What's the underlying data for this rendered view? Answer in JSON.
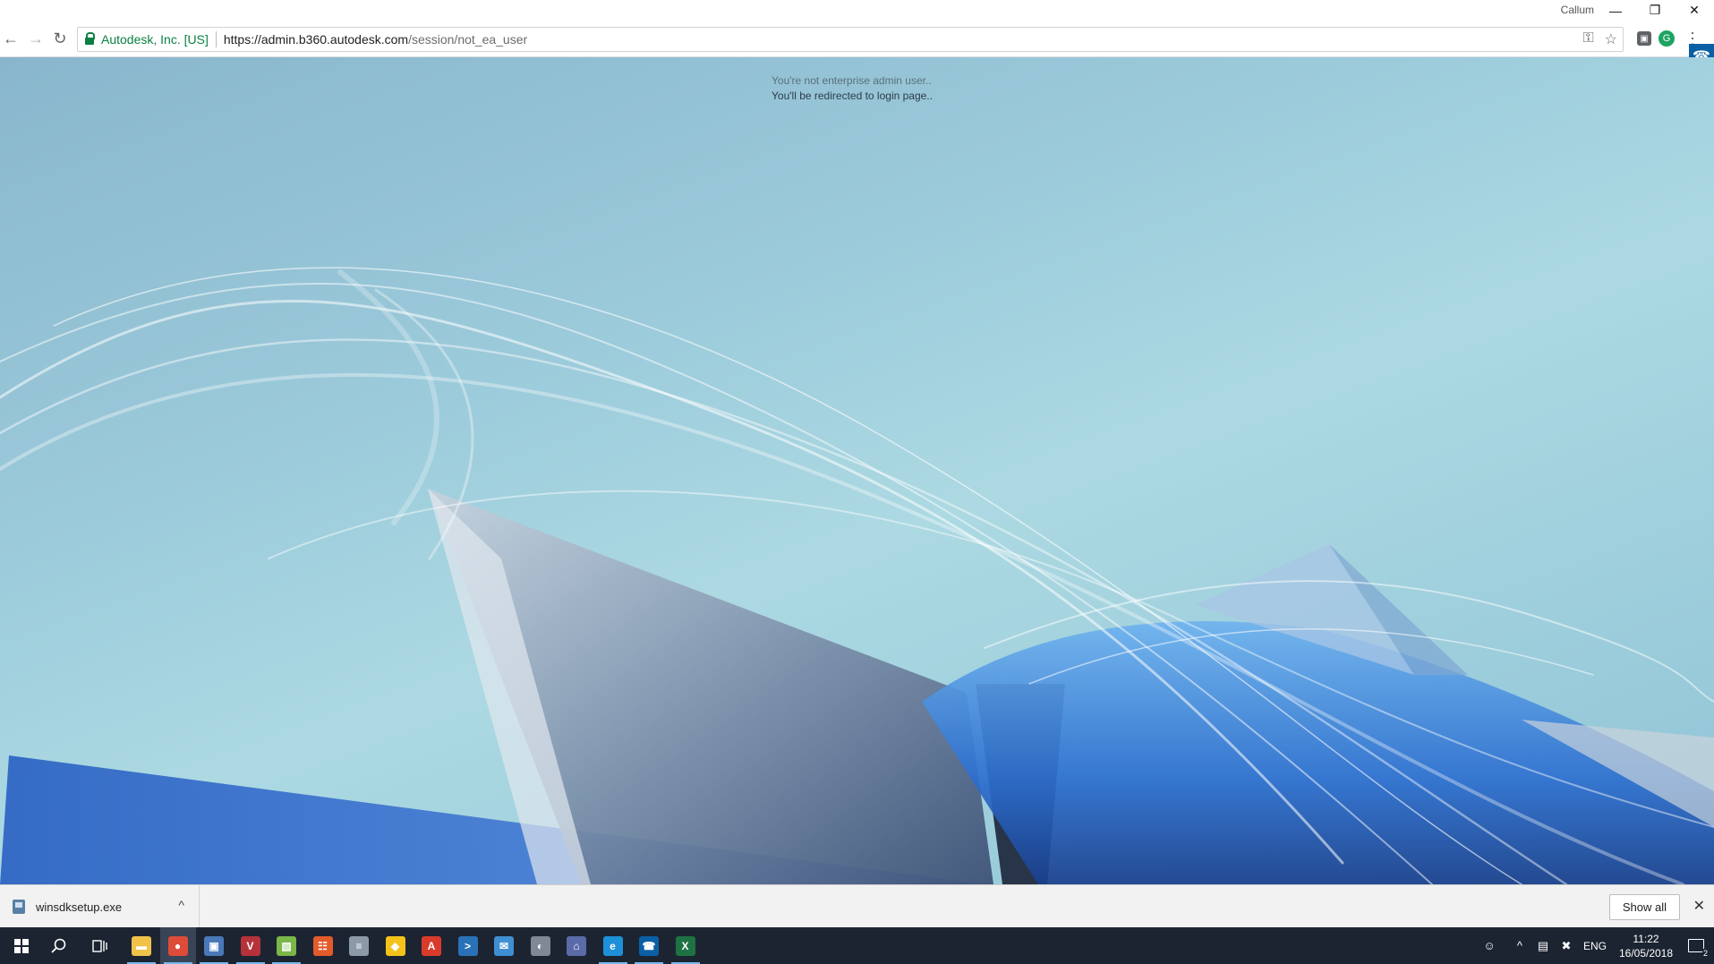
{
  "window": {
    "profile_name": "Callum",
    "minimize_label": "—",
    "restore_label": "❐",
    "close_label": "✕"
  },
  "toolbar": {
    "back_icon": "←",
    "forward_icon": "→",
    "reload_icon": "↻",
    "ev_name": "Autodesk, Inc. [US]",
    "url_host": "https://admin.b360.autodesk.com",
    "url_path": "/session/not_ea_user",
    "key_icon": "⚿",
    "star_icon": "☆",
    "ext1_label": "▣",
    "ext2_label": "G",
    "menu_icon": "⋮",
    "phone_icon": "☎"
  },
  "page": {
    "message_line1": "You're not enterprise admin user..",
    "message_line2": "You'll be redirected to login page.."
  },
  "downloads": {
    "file_name": "winsdksetup.exe",
    "chevron": "^",
    "show_all_label": "Show all",
    "close_label": "✕"
  },
  "taskbar": {
    "apps": [
      {
        "name": "file-explorer",
        "glyph": "▬",
        "color": "#f0c24a"
      },
      {
        "name": "chrome",
        "glyph": "●",
        "color": "#dd4b39"
      },
      {
        "name": "remote-desktop",
        "glyph": "▣",
        "color": "#4a78b8"
      },
      {
        "name": "vnc-viewer",
        "glyph": "V",
        "color": "#b5323a"
      },
      {
        "name": "vmware",
        "glyph": "▧",
        "color": "#7ab648"
      },
      {
        "name": "app-grid",
        "glyph": "☷",
        "color": "#e35b2b"
      },
      {
        "name": "notepad",
        "glyph": "≡",
        "color": "#8c9aa8"
      },
      {
        "name": "keepass",
        "glyph": "◆",
        "color": "#f3c21b"
      },
      {
        "name": "acrobat",
        "glyph": "A",
        "color": "#d93b2b"
      },
      {
        "name": "powershell",
        "glyph": ">",
        "color": "#2a72b8"
      },
      {
        "name": "outlook-mail",
        "glyph": "✉",
        "color": "#3f8fd2"
      },
      {
        "name": "mouse-tool",
        "glyph": "◐",
        "color": "#7f8894"
      },
      {
        "name": "network-tool",
        "glyph": "⌂",
        "color": "#5b6aa8"
      },
      {
        "name": "internet-explorer",
        "glyph": "e",
        "color": "#1e90d8"
      },
      {
        "name": "phone",
        "glyph": "☎",
        "color": "#0b5fa5"
      },
      {
        "name": "excel",
        "glyph": "X",
        "color": "#1f7244"
      }
    ],
    "tray": {
      "people_icon": "☺",
      "chevron_icon": "^",
      "network_icon": "▤",
      "volume_icon": "✖",
      "language": "ENG",
      "time": "11:22",
      "date": "16/05/2018",
      "notification_count": "2"
    }
  }
}
